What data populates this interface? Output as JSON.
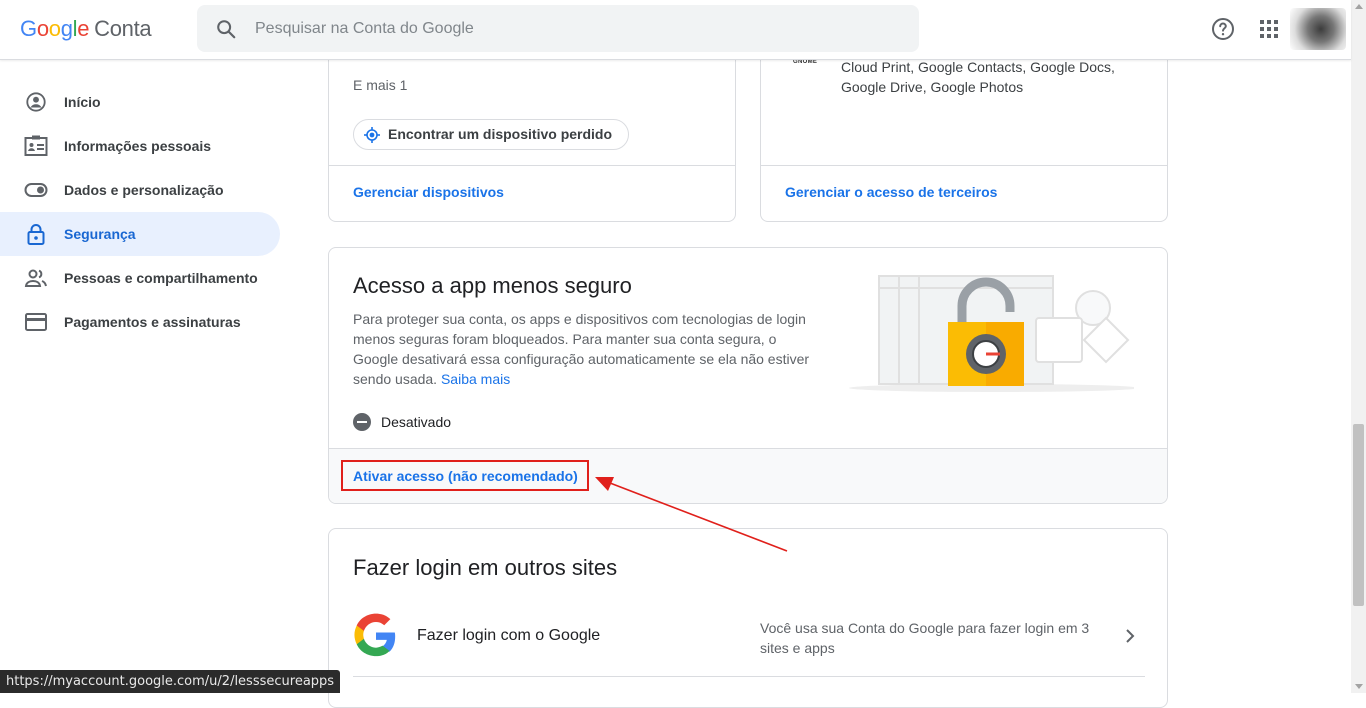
{
  "header": {
    "logo_google": [
      "G",
      "o",
      "o",
      "g",
      "l",
      "e"
    ],
    "logo_conta": "Conta",
    "search_placeholder": "Pesquisar na Conta do Google"
  },
  "nav": {
    "items": [
      {
        "label": "Início",
        "icon": "person-circle-icon"
      },
      {
        "label": "Informações pessoais",
        "icon": "id-card-icon"
      },
      {
        "label": "Dados e personalização",
        "icon": "toggle-icon"
      },
      {
        "label": "Segurança",
        "icon": "lock-icon",
        "active": true
      },
      {
        "label": "Pessoas e compartilhamento",
        "icon": "people-icon"
      },
      {
        "label": "Pagamentos e assinaturas",
        "icon": "credit-card-icon"
      }
    ]
  },
  "devices_card": {
    "more_text": "E mais 1",
    "find_device_label": "Encontrar um dispositivo perdido",
    "manage_link": "Gerenciar dispositivos"
  },
  "third_party_card": {
    "app_logo_text": "GNOME",
    "apps_text": "Cloud Print, Google Contacts, Google Docs, Google Drive, Google Photos",
    "manage_link": "Gerenciar o acesso de terceiros"
  },
  "less_secure_card": {
    "title": "Acesso a app menos seguro",
    "description": "Para proteger sua conta, os apps e dispositivos com tecnologias de login menos seguras foram bloqueados. Para manter sua conta segura, o Google desativará essa configuração automaticamente se ela não estiver sendo usada.",
    "learn_more": "Saiba mais",
    "status": "Desativado",
    "action_link": "Ativar acesso (não recomendado)",
    "accent_color": "#1a73e8",
    "highlight_color": "#e0201b"
  },
  "login_card": {
    "title": "Fazer login em outros sites",
    "row_title": "Fazer login com o Google",
    "row_desc": "Você usa sua Conta do Google para fazer login em 3 sites e apps"
  },
  "statusbar": {
    "url": "https://myaccount.google.com/u/2/lesssecureapps"
  }
}
